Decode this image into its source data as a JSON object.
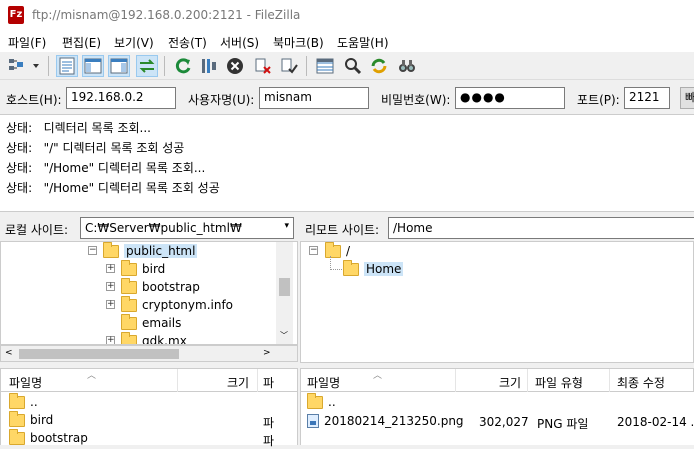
{
  "window": {
    "title": "ftp://misnam@192.168.0.200:2121 - FileZilla",
    "icon_text": "Fz"
  },
  "menu": [
    "파일(F)",
    "편집(E)",
    "보기(V)",
    "전송(T)",
    "서버(S)",
    "북마크(B)",
    "도움말(H)"
  ],
  "toolbar": {
    "icons": [
      "site-manager-icon",
      "dropdown-arrow-icon",
      "toggle-log-icon",
      "toggle-local-tree-icon",
      "toggle-remote-tree-icon",
      "toggle-queue-icon",
      "refresh-icon",
      "process-queue-icon",
      "cancel-icon",
      "disconnect-icon",
      "reconnect-icon",
      "directory-listing-filters-icon",
      "compare-icon",
      "sync-browse-icon",
      "search-icon"
    ]
  },
  "quickconnect": {
    "host_label": "호스트(H):",
    "host_value": "192.168.0.2",
    "user_label": "사용자명(U):",
    "user_value": "misnam",
    "pass_label": "비밀번호(W):",
    "pass_value": "●●●●",
    "port_label": "포트(P):",
    "port_value": "2121",
    "connect_label": "빠"
  },
  "log": [
    {
      "status": "상태:",
      "message": "디렉터리 목록 조회..."
    },
    {
      "status": "상태:",
      "message": "\"/\" 디렉터리 목록 조회 성공"
    },
    {
      "status": "상태:",
      "message": "\"/Home\" 디렉터리 목록 조회..."
    },
    {
      "status": "상태:",
      "message": "\"/Home\" 디렉터리 목록 조회 성공"
    }
  ],
  "local": {
    "label": "로컬 사이트:",
    "path": "C:₩Server₩public_html₩",
    "tree": [
      "public_html",
      "bird",
      "bootstrap",
      "cryptonym.info",
      "emails",
      "gdk.mx"
    ],
    "columns": [
      "파일명",
      "크기",
      "파"
    ],
    "files": [
      {
        "name": "..",
        "size": "",
        "type": ""
      },
      {
        "name": "bird",
        "size": "",
        "type": "파"
      },
      {
        "name": "bootstrap",
        "size": "",
        "type": "파"
      }
    ]
  },
  "remote": {
    "label": "리모트 사이트:",
    "path": "/Home",
    "tree": [
      "/",
      "Home"
    ],
    "columns": [
      "파일명",
      "크기",
      "파일 유형",
      "최종 수정"
    ],
    "files": [
      {
        "name": "..",
        "size": "",
        "type": "",
        "modified": ""
      },
      {
        "name": "20180214_213250.png",
        "size": "302,027",
        "type": "PNG 파일",
        "modified": "2018-02-14 ..."
      }
    ]
  },
  "colors": {
    "folder": "#ffd766",
    "app_red": "#b40000"
  }
}
